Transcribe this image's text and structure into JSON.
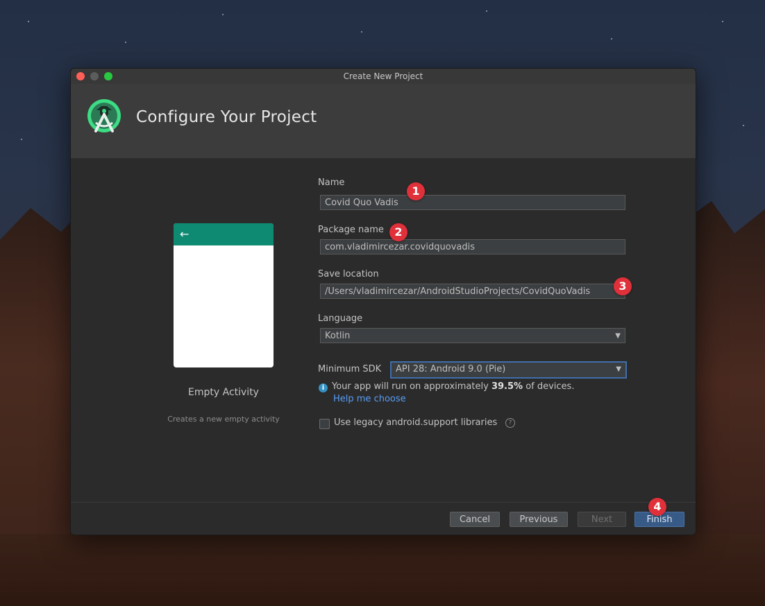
{
  "window": {
    "title": "Create New Project"
  },
  "header": {
    "title": "Configure Your Project",
    "logo_icon": "android-studio-logo"
  },
  "template": {
    "name": "Empty Activity",
    "description": "Creates a new empty activity",
    "arrow": "←"
  },
  "form": {
    "name": {
      "label": "Name",
      "value": "Covid Quo Vadis"
    },
    "package": {
      "label": "Package name",
      "value": "com.vladimircezar.covidquovadis"
    },
    "save_location": {
      "label": "Save location",
      "value": "/Users/vladimircezar/AndroidStudioProjects/CovidQuoVadis"
    },
    "language": {
      "label": "Language",
      "value": "Kotlin"
    },
    "min_sdk": {
      "label": "Minimum SDK",
      "value": "API 28: Android 9.0 (Pie)"
    },
    "info_prefix": "Your app will run on approximately",
    "info_percent": "39.5%",
    "info_suffix": "of devices.",
    "help_link": "Help me choose",
    "legacy_label": "Use legacy android.support libraries",
    "legacy_checked": false
  },
  "buttons": {
    "cancel": "Cancel",
    "previous": "Previous",
    "next": "Next",
    "finish": "Finish"
  },
  "annotations": [
    "1",
    "2",
    "3",
    "4"
  ],
  "colors": {
    "accent": "#375a86",
    "badge": "#e0303a",
    "toolbar_green": "#0f8a72"
  }
}
